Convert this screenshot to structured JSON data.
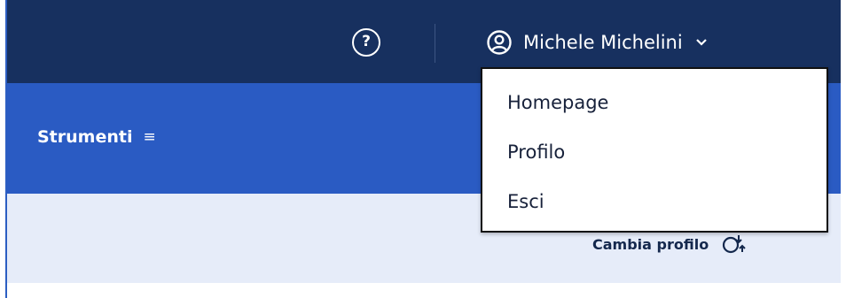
{
  "header": {
    "help_glyph": "?",
    "help_icon": "question-circle-icon",
    "user_icon": "user-circle-icon",
    "user_name": "Michele Michelini",
    "dropdown_icon": "chevron-down-icon"
  },
  "toolbar": {
    "label": "Strumenti",
    "menu_glyph": "≡",
    "menu_icon": "hamburger-icon"
  },
  "profile_switch": {
    "label": "Cambia profilo",
    "icon": "switch-profile-icon"
  },
  "user_dropdown": {
    "items": [
      {
        "label": "Homepage"
      },
      {
        "label": "Profilo"
      },
      {
        "label": "Esci"
      }
    ]
  },
  "colors": {
    "topbar": "#17305f",
    "toolbar": "#2a5bc3",
    "lightband": "#e6ecf9"
  }
}
